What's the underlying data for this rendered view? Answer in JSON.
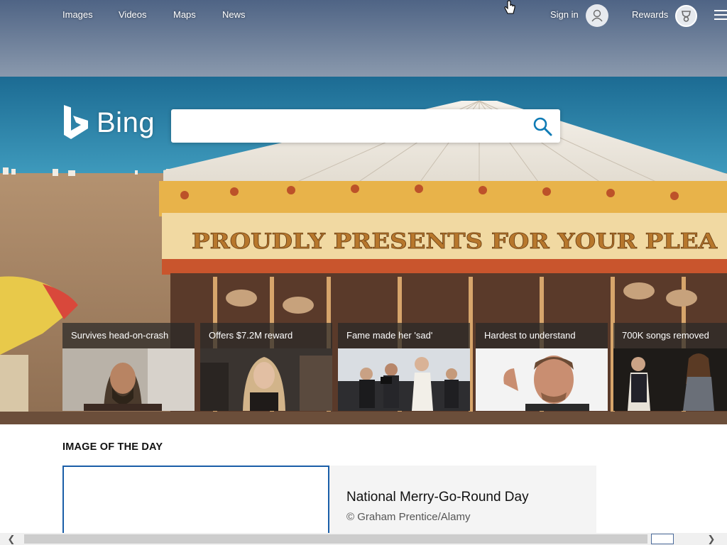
{
  "nav": {
    "links": [
      "Images",
      "Videos",
      "Maps",
      "News"
    ],
    "signin_label": "Sign in",
    "rewards_label": "Rewards"
  },
  "logo": {
    "text": "Bing"
  },
  "search": {
    "value": "",
    "placeholder": ""
  },
  "cards": [
    {
      "title": "Survives head-on-crash"
    },
    {
      "title": "Offers $7.2M reward"
    },
    {
      "title": "Fame made her 'sad'"
    },
    {
      "title": "Hardest to understand"
    },
    {
      "title": "700K songs removed"
    }
  ],
  "image_of_the_day": {
    "heading": "IMAGE OF THE DAY",
    "title": "National Merry-Go-Round Day",
    "credit": "© Graham Prentice/Alamy"
  },
  "hero_banner_text": "PROUDLY PRESENTS FOR YOUR PLEA",
  "colors": {
    "accent": "#1a5ea8",
    "search_icon": "#0f7bb5",
    "sea": "#2d7ea3",
    "sky": "#5b6e8c"
  },
  "icons": {
    "search": "search-icon",
    "avatar": "user-icon",
    "rewards": "trophy-icon",
    "menu": "hamburger-menu-icon",
    "cursor": "hand-cursor-icon"
  }
}
